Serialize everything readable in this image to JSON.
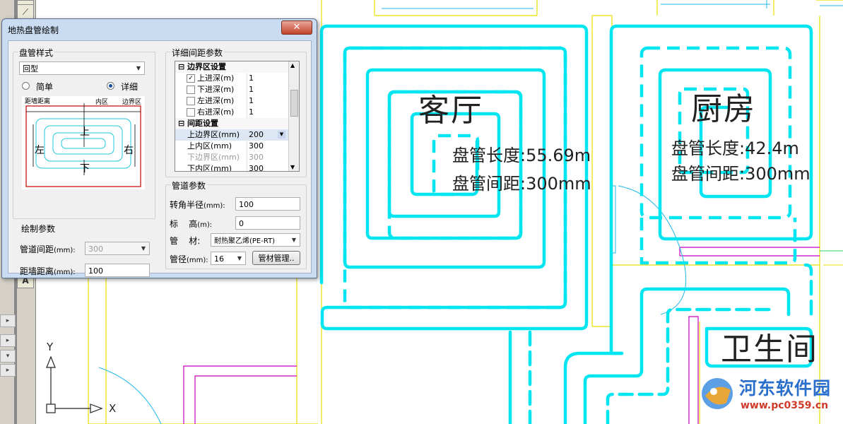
{
  "colors": {
    "pipe": "#00e5f0",
    "wall": "#e8e000",
    "magenta": "#c400c4",
    "dialog_frame": "#c9dcf1",
    "close": "#c2442b"
  },
  "drawing": {
    "rooms": [
      {
        "name": "客厅",
        "length_text": "盘管长度:55.69m",
        "spacing_text": "盘管间距:300mm"
      },
      {
        "name": "厨房",
        "length_text": "盘管长度:42.4m",
        "spacing_text": "盘管间距:300mm"
      },
      {
        "name": "卫生间"
      }
    ],
    "axis": {
      "y": "Y",
      "x": "X"
    }
  },
  "leftbar": {
    "a_button": "A"
  },
  "dialog": {
    "title": "地热盘管绘制",
    "close_icon": "close-icon",
    "coil_style": {
      "group_title": "盘管样式",
      "selected": "回型",
      "radio_simple": "简单",
      "radio_detail": "详细",
      "preview_labels": {
        "left_wall": "距墙距离",
        "inner": "内区",
        "edge": "边界区",
        "top": "上",
        "bottom": "下",
        "left": "左",
        "right": "右"
      }
    },
    "draw_params": {
      "group_title": "绘制参数",
      "pipe_spacing_label": "管道间距",
      "pipe_spacing_unit": "(mm):",
      "pipe_spacing_value": "300",
      "wall_distance_label": "距墙距离",
      "wall_distance_unit": "(mm):",
      "wall_distance_value": "100"
    },
    "detail_params": {
      "group_title": "详细间距参数",
      "boundary_category": "边界区设置",
      "boundary_rows": [
        {
          "label": "上进深(m)",
          "value": "1",
          "checked": true
        },
        {
          "label": "下进深(m)",
          "value": "1",
          "checked": false
        },
        {
          "label": "左进深(m)",
          "value": "1",
          "checked": false
        },
        {
          "label": "右进深(m)",
          "value": "1",
          "checked": false
        }
      ],
      "spacing_category": "间距设置",
      "spacing_rows": [
        {
          "label": "上边界区(mm)",
          "value": "200",
          "disabled": false
        },
        {
          "label": "上内区(mm)",
          "value": "300",
          "disabled": false
        },
        {
          "label": "下边界区(mm)",
          "value": "300",
          "disabled": true
        },
        {
          "label": "下内区(mm)",
          "value": "300",
          "disabled": false
        }
      ]
    },
    "pipe_params": {
      "group_title": "管道参数",
      "turn_radius_label": "转角半径",
      "turn_radius_unit": "(mm):",
      "turn_radius_value": "100",
      "elevation_label": "标    高",
      "elevation_unit": "(m):",
      "elevation_value": "0",
      "material_label": "管    材:",
      "material_value": "耐热聚乙烯(PE-RT)",
      "diameter_label": "管径",
      "diameter_unit": "(mm):",
      "diameter_value": "16",
      "material_button": "管材管理.."
    }
  },
  "watermark": {
    "site_name": "河东软件园",
    "url": "www.pc0359.cn"
  }
}
